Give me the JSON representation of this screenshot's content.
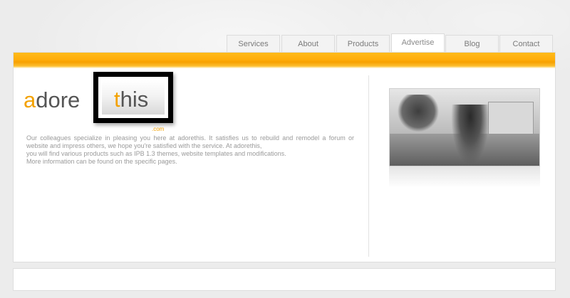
{
  "nav": {
    "tabs": [
      {
        "label": "Services"
      },
      {
        "label": "About"
      },
      {
        "label": "Products"
      },
      {
        "label": "Advertise"
      },
      {
        "label": "Blog"
      },
      {
        "label": "Contact"
      }
    ],
    "active_tab": "Advertise"
  },
  "logo": {
    "adore_first": "a",
    "adore_rest": "dore",
    "this_first": "t",
    "this_rest": "his",
    "suffix": ".com"
  },
  "description": {
    "line1": "Our colleagues specialize in pleasing you here at adorethis. It satisfies us to rebuild and remodel a forum or website and impress others, we hope you're satisfied with the service. At adorethis,",
    "line2": "you will find various products such as IPB 1.3 themes, website templates and modifications.",
    "line3": "More information can be found on the specific pages."
  },
  "colors": {
    "accent": "#f3a100",
    "bar": "#ffad0a",
    "text": "#9a9a9a"
  }
}
